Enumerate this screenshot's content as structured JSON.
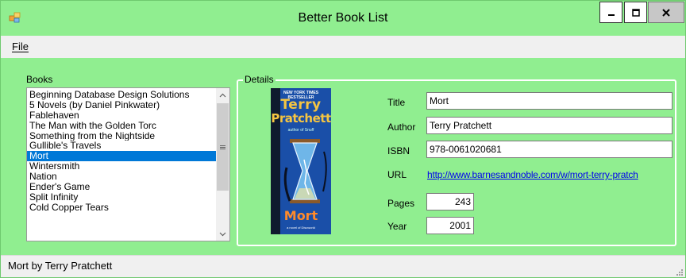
{
  "window": {
    "title": "Better Book List",
    "controls": {
      "minimize": "minimize-icon",
      "maximize": "maximize-icon",
      "close": "close-icon"
    }
  },
  "menu": {
    "items": [
      {
        "label": "File"
      }
    ]
  },
  "books": {
    "label": "Books",
    "items": [
      "Beginning Database Design Solutions",
      "5 Novels (by Daniel Pinkwater)",
      "Fablehaven",
      "The Man with the Golden Torc",
      "Something from the Nightside",
      "Gullible's Travels",
      "Mort",
      "Wintersmith",
      "Nation",
      "Ender's Game",
      "Split Infinity",
      "Cold Copper Tears"
    ],
    "selected_index": 6
  },
  "details": {
    "label": "Details",
    "cover": {
      "tagline": "NEW YORK TIMES BESTSELLER",
      "author_line1": "Terry",
      "author_line2": "Pratchett",
      "title": "Mort",
      "subtitle": "author of Snuff",
      "bottom_text": "a novel of Discworld"
    },
    "fields": {
      "title_label": "Title",
      "title_value": "Mort",
      "author_label": "Author",
      "author_value": "Terry Pratchett",
      "isbn_label": "ISBN",
      "isbn_value": "978-0061020681",
      "url_label": "URL",
      "url_value": "http://www.barnesandnoble.com/w/mort-terry-pratch",
      "pages_label": "Pages",
      "pages_value": "243",
      "year_label": "Year",
      "year_value": "2001"
    }
  },
  "status": {
    "text": "Mort by Terry Pratchett"
  },
  "colors": {
    "form_background": "#90ee90",
    "selection": "#0078d7",
    "link": "#0000ee",
    "cover_blue": "#1a4fa8",
    "cover_author": "#f5c542",
    "cover_title": "#ff8a2a"
  }
}
